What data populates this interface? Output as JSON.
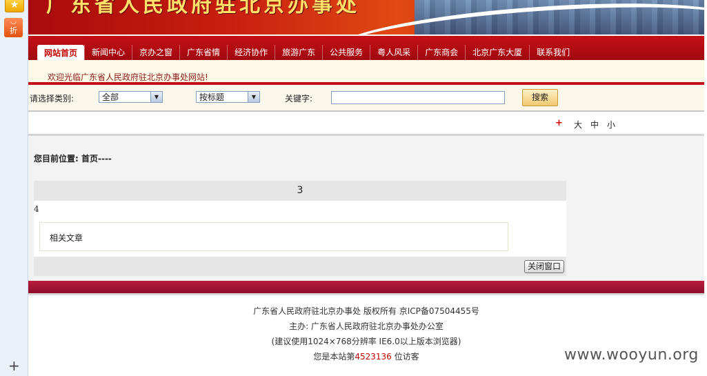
{
  "left_rail": {
    "favorite_icon": "star-icon",
    "deal_label": "折",
    "add_label": "+"
  },
  "banner": {
    "title": "广东省人民政府驻北京办事处"
  },
  "nav": {
    "items": [
      "网站首页",
      "新闻中心",
      "京办之窗",
      "广东省情",
      "经济协作",
      "旅游广东",
      "公共服务",
      "粤人风采",
      "广东商会",
      "北京广东大厦",
      "联系我们"
    ],
    "active_index": 0
  },
  "welcome": {
    "text": "欢迎光临广东省人民政府驻北京办事处网站!"
  },
  "search": {
    "category_label": "请选择类别:",
    "category_value": "全部",
    "mode_value": "按标题",
    "keyword_label": "关键字:",
    "keyword_value": "",
    "button_label": "搜索"
  },
  "font_size": {
    "plus_label": "+",
    "large": "大",
    "medium": "中",
    "small": "小"
  },
  "content": {
    "breadcrumb": "您目前位置: 首页----",
    "article_title": "3",
    "article_body": "4",
    "related_label": "相关文章",
    "close_label": "关闭窗口"
  },
  "footer": {
    "line1": "广东省人民政府驻北京办事处 版权所有 京ICP备07504455号",
    "line2": "主办: 广东省人民政府驻北京办事处办公室",
    "line3": "(建议使用1024×768分辨率 IE6.0以上版本浏览器)",
    "visits_prefix": "您是本站第",
    "visits_count": "4523136",
    "visits_suffix": " 位访客"
  },
  "watermark": "www.wooyun.org"
}
